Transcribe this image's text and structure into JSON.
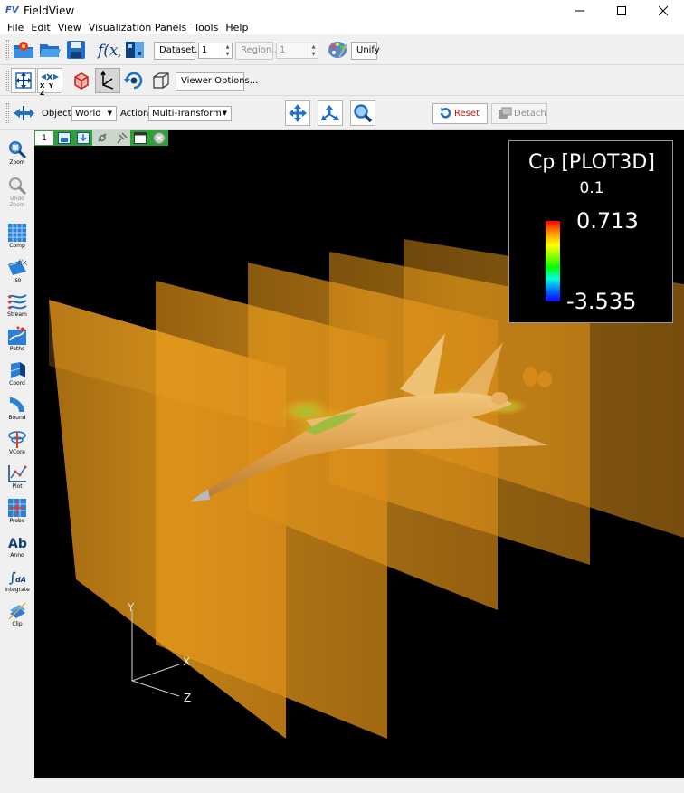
{
  "window": {
    "title": "FieldView",
    "app_icon_text": "FV"
  },
  "menu": {
    "items": [
      "File",
      "Edit",
      "View",
      "Visualization Panels",
      "Tools",
      "Help"
    ]
  },
  "toolbar1": {
    "dataset_button": "Dataset...",
    "dataset_value": "1",
    "region_button": "Region...",
    "region_value": "1",
    "unify_button": "Unify"
  },
  "toolbar2": {
    "axes_label": "X Y Z",
    "viewer_options_button": "Viewer Options..."
  },
  "toolbar3": {
    "object_label": "Object:",
    "object_value": "World",
    "action_label": "Action:",
    "action_value": "Multi-Transform",
    "reset_button": "Reset",
    "detach_button": "Detach"
  },
  "side_tools": [
    {
      "label": "Zoom",
      "icon": "zoom-icon",
      "enabled": true
    },
    {
      "label": "Undo\nZoom",
      "icon": "undo-zoom-icon",
      "enabled": false
    },
    {
      "label": "Comp",
      "icon": "computational-surface-icon",
      "enabled": true
    },
    {
      "label": "Iso",
      "icon": "iso-surface-icon",
      "enabled": true
    },
    {
      "label": "Stream",
      "icon": "streamlines-icon",
      "enabled": true
    },
    {
      "label": "Paths",
      "icon": "particle-paths-icon",
      "enabled": true
    },
    {
      "label": "Coord",
      "icon": "coordinate-surface-icon",
      "enabled": true
    },
    {
      "label": "Bound",
      "icon": "boundary-surface-icon",
      "enabled": true
    },
    {
      "label": "VCore",
      "icon": "vortex-core-icon",
      "enabled": true
    },
    {
      "label": "Plot",
      "icon": "plot-icon",
      "enabled": true
    },
    {
      "label": "Probe",
      "icon": "probe-icon",
      "enabled": true
    },
    {
      "label": "Anno",
      "icon": "annotation-icon",
      "enabled": true
    },
    {
      "label": "Integrate",
      "icon": "integrate-icon",
      "enabled": true
    },
    {
      "label": "Clip",
      "icon": "clip-icon",
      "enabled": true
    }
  ],
  "viewer": {
    "tab_number": "1",
    "legend": {
      "title": "Cp [PLOT3D]",
      "increment": "0.1",
      "max": "0.713",
      "min": "-3.535"
    },
    "axes": {
      "x": "X",
      "y": "Y",
      "z": "Z"
    }
  },
  "colors": {
    "viewer_background": "#000000",
    "plane_orange": "#f0a020",
    "aircraft_body": "#e8a955",
    "accent_blue": "#1e5fb8"
  }
}
